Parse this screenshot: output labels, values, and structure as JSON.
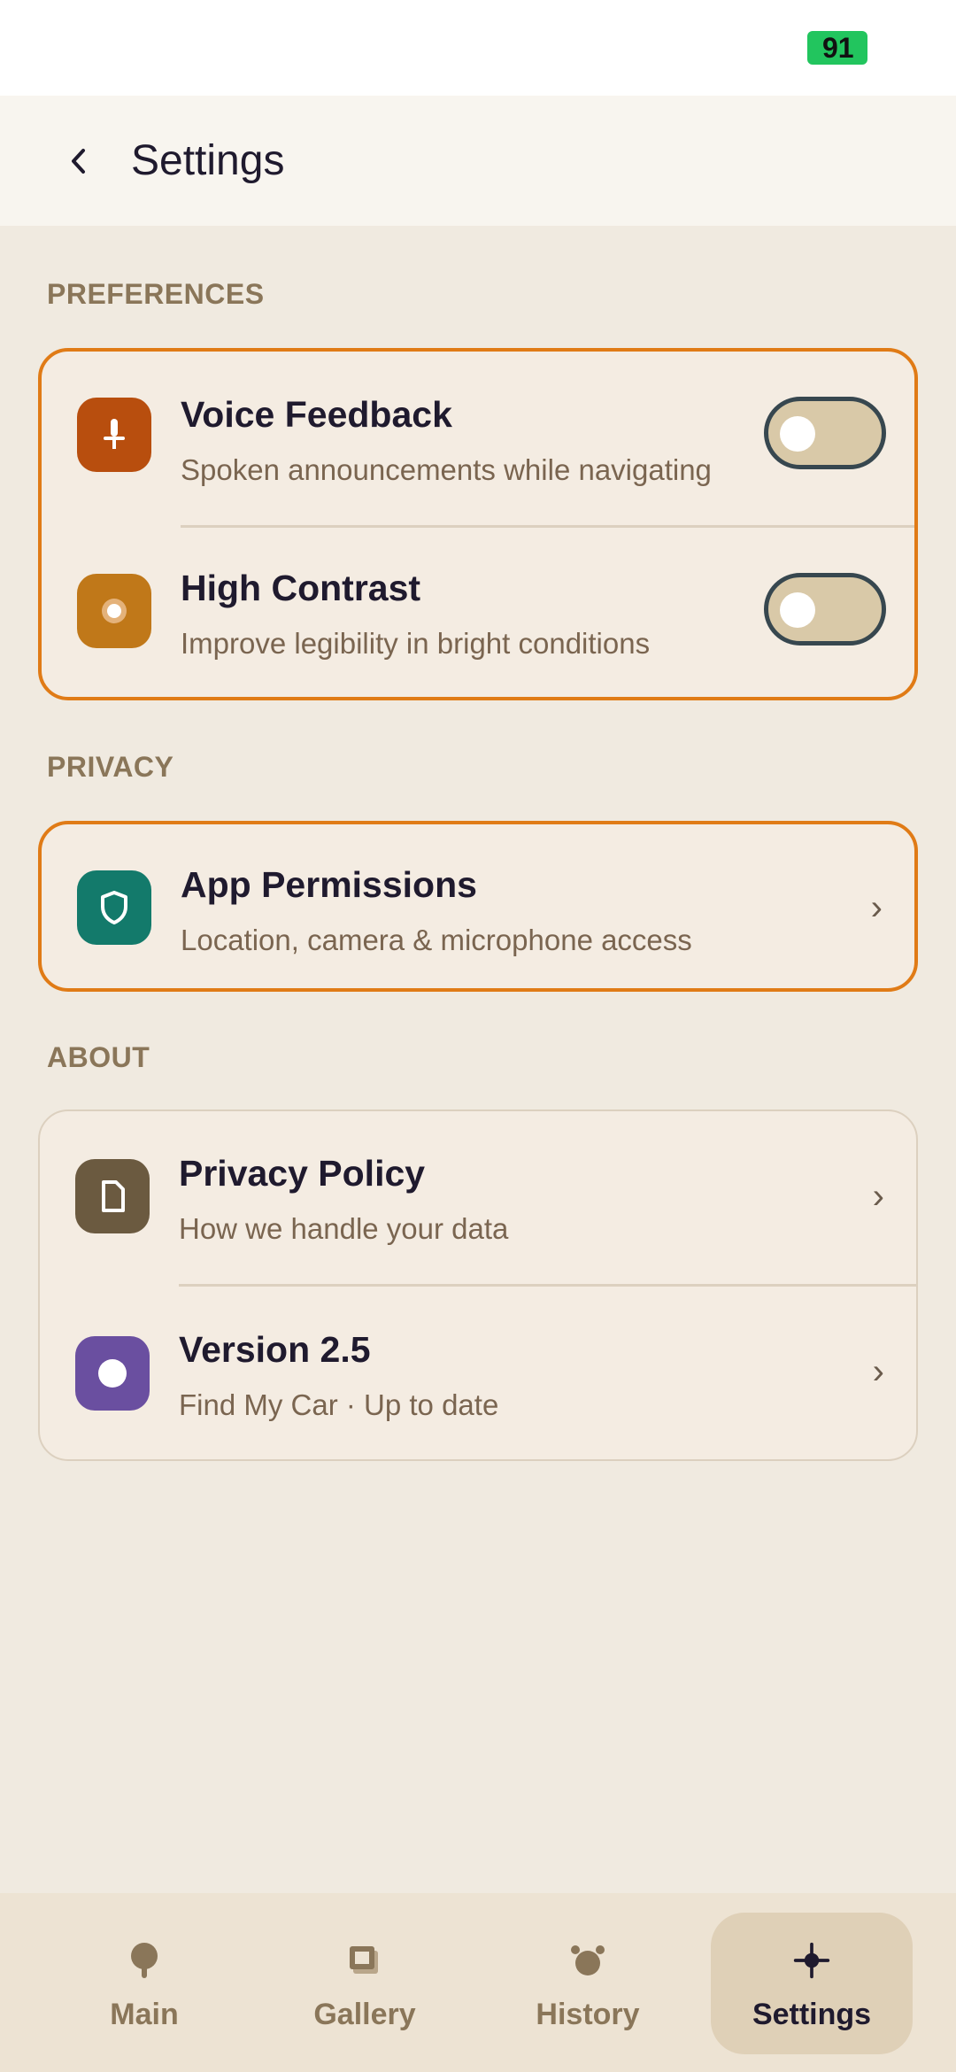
{
  "status_bar": {
    "battery": "91"
  },
  "header": {
    "title": "Settings",
    "back_icon": "chevron-left-icon"
  },
  "sections": {
    "preferences": {
      "label": "PREFERENCES",
      "items": [
        {
          "title": "Voice Feedback",
          "subtitle": "Spoken announcements while navigating",
          "icon": "microphone-icon",
          "icon_color": "#B84E0E",
          "toggle_on": false
        },
        {
          "title": "High Contrast",
          "subtitle": "Improve legibility in bright conditions",
          "icon": "contrast-icon",
          "icon_color": "#C07819",
          "toggle_on": false
        }
      ]
    },
    "privacy": {
      "label": "PRIVACY",
      "items": [
        {
          "title": "App Permissions",
          "subtitle": "Location, camera & microphone access",
          "icon": "shield-icon",
          "icon_color": "#137A6B"
        }
      ]
    },
    "about": {
      "label": "ABOUT",
      "items": [
        {
          "title": "Privacy Policy",
          "subtitle": "How we handle your data",
          "icon": "document-icon",
          "icon_color": "#6B5A40"
        },
        {
          "title": "Version 2.5",
          "subtitle": "Find My Car · Up to date",
          "icon": "info-dot-icon",
          "icon_color": "#6A4FA0"
        }
      ]
    }
  },
  "colors": {
    "accent": "#E07B16",
    "background": "#F0EAE0",
    "card": "#F4ECE2"
  },
  "bottom_nav": {
    "active": "Settings",
    "items": [
      {
        "label": "Main",
        "icon": "map-pin-icon"
      },
      {
        "label": "Gallery",
        "icon": "gallery-icon"
      },
      {
        "label": "History",
        "icon": "history-icon"
      },
      {
        "label": "Settings",
        "icon": "settings-icon"
      }
    ]
  }
}
